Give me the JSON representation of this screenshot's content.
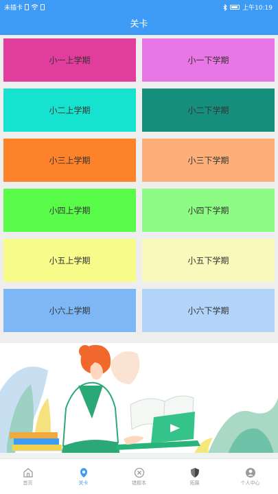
{
  "status_bar": {
    "carrier": "未插卡",
    "time": "上午10:19",
    "icons": [
      "sim-icon",
      "wifi-icon",
      "bluetooth-icon",
      "battery-icon"
    ]
  },
  "header": {
    "title": "关卡"
  },
  "levels": [
    {
      "label": "小一上学期",
      "color": "#e13d9c"
    },
    {
      "label": "小一下学期",
      "color": "#e877e5"
    },
    {
      "label": "小二上学期",
      "color": "#16e3cf"
    },
    {
      "label": "小二下学期",
      "color": "#158e7b"
    },
    {
      "label": "小三上学期",
      "color": "#fd8229"
    },
    {
      "label": "小三下学期",
      "color": "#fdaf7a"
    },
    {
      "label": "小四上学期",
      "color": "#5afc4a"
    },
    {
      "label": "小四下学期",
      "color": "#8dfc85"
    },
    {
      "label": "小五上学期",
      "color": "#f6fb8a"
    },
    {
      "label": "小五下学期",
      "color": "#f8f9bb"
    },
    {
      "label": "小六上学期",
      "color": "#7db7f5"
    },
    {
      "label": "小六下学期",
      "color": "#b1d4f8"
    }
  ],
  "tabbar": {
    "tabs": [
      {
        "label": "首页",
        "icon": "home-icon",
        "active": false
      },
      {
        "label": "关卡",
        "icon": "level-icon",
        "active": true
      },
      {
        "label": "错题本",
        "icon": "wrong-book-icon",
        "active": false
      },
      {
        "label": "拓展",
        "icon": "shield-icon",
        "active": false
      },
      {
        "label": "个人中心",
        "icon": "profile-icon",
        "active": false
      }
    ]
  },
  "colors": {
    "primary": "#3d9bf5",
    "tab_inactive": "#9a9a9a",
    "background": "#eeeeee"
  }
}
